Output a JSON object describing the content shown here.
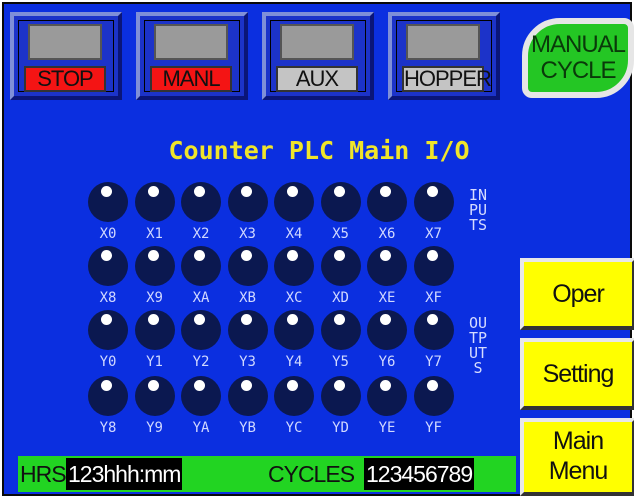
{
  "top_buttons": [
    {
      "label": "STOP",
      "color": "red"
    },
    {
      "label": "MANL",
      "color": "red"
    },
    {
      "label": "AUX",
      "color": "gray"
    },
    {
      "label": "HOPPER",
      "color": "gray"
    }
  ],
  "manual_cycle": {
    "line1": "MANUAL",
    "line2": "CYCLE"
  },
  "title": "Counter PLC Main I/O",
  "inputs_label": "INPUTS",
  "outputs_label": "OUTPUTS",
  "io_rows": [
    [
      "X0",
      "X1",
      "X2",
      "X3",
      "X4",
      "X5",
      "X6",
      "X7"
    ],
    [
      "X8",
      "X9",
      "XA",
      "XB",
      "XC",
      "XD",
      "XE",
      "XF"
    ],
    [
      "Y0",
      "Y1",
      "Y2",
      "Y3",
      "Y4",
      "Y5",
      "Y6",
      "Y7"
    ],
    [
      "Y8",
      "Y9",
      "YA",
      "YB",
      "YC",
      "YD",
      "YE",
      "YF"
    ]
  ],
  "side_buttons": {
    "oper": "Oper",
    "setting": "Setting",
    "main_menu_1": "Main",
    "main_menu_2": "Menu"
  },
  "status": {
    "hrs_label": "HRS",
    "hrs_value": "123hhh:mm",
    "cycles_label": "CYCLES",
    "cycles_value": "123456789"
  },
  "colors": {
    "screen": "#0b2fe0",
    "title": "#f0e52a",
    "status_bar": "#22d422",
    "side_button": "#ffff00"
  }
}
